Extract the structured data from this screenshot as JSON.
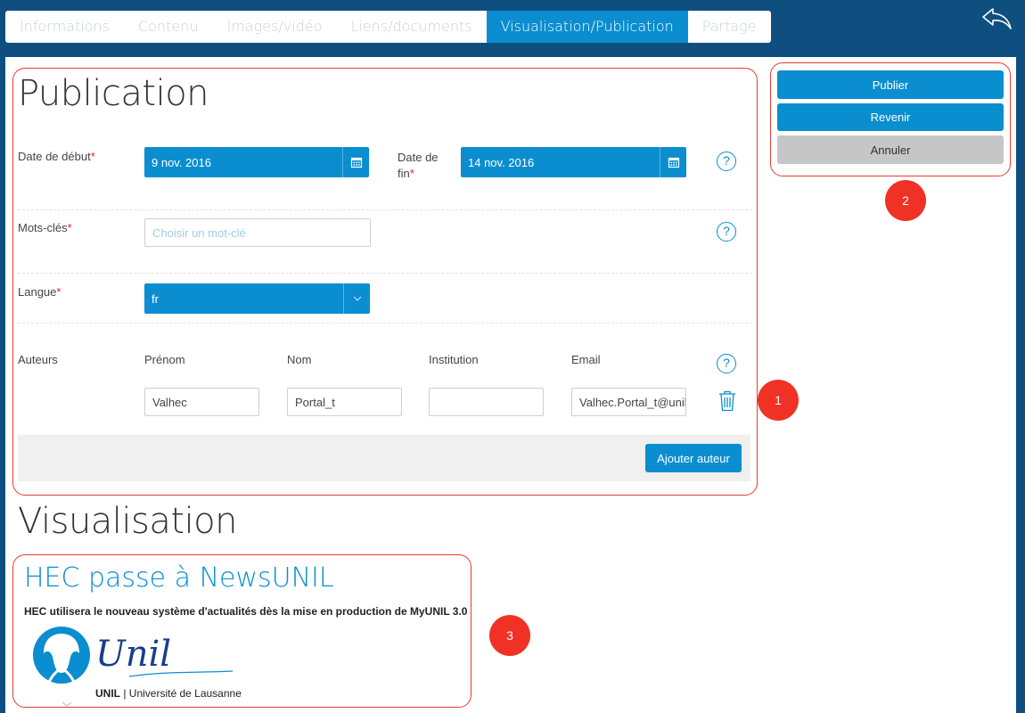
{
  "tabs": [
    {
      "label": "Informations",
      "active": false
    },
    {
      "label": "Contenu",
      "active": false
    },
    {
      "label": "Images/vidéo",
      "active": false
    },
    {
      "label": "Liens/documents",
      "active": false
    },
    {
      "label": "Visualisation/Publication",
      "active": true
    },
    {
      "label": "Partage",
      "active": false
    }
  ],
  "publication": {
    "title": "Publication",
    "start_date_label": "Date de début",
    "start_date_value": "9 nov. 2016",
    "end_date_label_1": "Date de",
    "end_date_label_2": "fin",
    "end_date_value": "14 nov. 2016",
    "keywords_label": "Mots-clés",
    "keywords_placeholder": "Choisir un mot-clé",
    "language_label": "Langue",
    "language_value": "fr",
    "authors_label": "Auteurs",
    "columns": {
      "firstname": "Prénom",
      "lastname": "Nom",
      "institution": "Institution",
      "email": "Email"
    },
    "author": {
      "firstname": "Valhec",
      "lastname": "Portal_t",
      "institution": "",
      "email": "Valhec.Portal_t@unil.c"
    },
    "add_author_label": "Ajouter auteur",
    "required_mark": "*",
    "help_mark": "?"
  },
  "actions": {
    "publish": "Publier",
    "back": "Revenir",
    "cancel": "Annuler"
  },
  "badges": [
    "1",
    "2",
    "3"
  ],
  "visualisation": {
    "title": "Visualisation",
    "news_title": "HEC passe à NewsUNIL",
    "news_subtitle": "HEC utilisera le nouveau système d'actualités dès la mise en production de MyUNIL 3.0",
    "logo_script": "Unil",
    "logo_caption_bold": "UNIL",
    "logo_caption_rest": " | Université de Lausanne"
  },
  "colors": {
    "primary": "#0a8ecf",
    "background": "#0e4f7f",
    "annotation": "#e63c2e",
    "required": "#e2231a"
  }
}
